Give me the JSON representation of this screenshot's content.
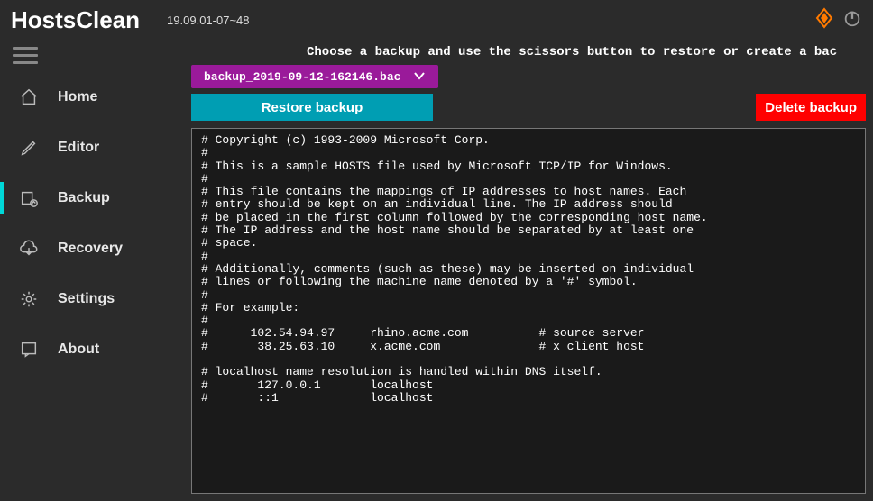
{
  "app": {
    "title": "HostsClean",
    "version": "19.09.01-07~48"
  },
  "sidebar": {
    "items": [
      {
        "label": "Home"
      },
      {
        "label": "Editor"
      },
      {
        "label": "Backup"
      },
      {
        "label": "Recovery"
      },
      {
        "label": "Settings"
      },
      {
        "label": "About"
      }
    ]
  },
  "main": {
    "instruction": "Choose a backup and use the scissors button to restore or create a bac",
    "selected_backup": "backup_2019-09-12-162146.bac",
    "restore_label": "Restore backup",
    "delete_label": "Delete backup",
    "file_contents": "# Copyright (c) 1993-2009 Microsoft Corp.\n#\n# This is a sample HOSTS file used by Microsoft TCP/IP for Windows.\n#\n# This file contains the mappings of IP addresses to host names. Each\n# entry should be kept on an individual line. The IP address should\n# be placed in the first column followed by the corresponding host name.\n# The IP address and the host name should be separated by at least one\n# space.\n#\n# Additionally, comments (such as these) may be inserted on individual\n# lines or following the machine name denoted by a '#' symbol.\n#\n# For example:\n#\n#      102.54.94.97     rhino.acme.com          # source server\n#       38.25.63.10     x.acme.com              # x client host\n\n# localhost name resolution is handled within DNS itself.\n#       127.0.0.1       localhost\n#       ::1             localhost"
  }
}
